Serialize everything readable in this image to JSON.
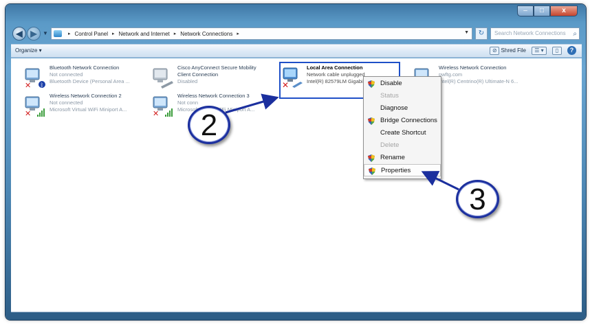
{
  "window": {
    "minimize_glyph": "–",
    "maximize_glyph": "□",
    "close_glyph": "x"
  },
  "navigation": {
    "back_glyph": "◀",
    "forward_glyph": "▶",
    "dropdown_glyph": "▼",
    "breadcrumb": [
      "Control Panel",
      "Network and Internet",
      "Network Connections"
    ],
    "separator": "▸",
    "refresh_glyph": "↻",
    "search_placeholder": "Search Network Connections",
    "search_icon": "search-icon"
  },
  "toolbar": {
    "organize_label": "Organize ▾",
    "shred_label": "Shred File",
    "view_glyph": "☰ ▾",
    "pane_glyph": "▯",
    "help_glyph": "?"
  },
  "connections": [
    {
      "name": "Bluetooth Network Connection",
      "status": "Not connected",
      "device": "Bluetooth Device (Personal Area ..."
    },
    {
      "name": "Cisco AnyConnect Secure Mobility",
      "name2": "Client Connection",
      "status": "Disabled",
      "device": ""
    },
    {
      "name": "Local Area Connection",
      "status": "Network cable unplugged",
      "device": "Intel(R) 82579LM Gigabit"
    },
    {
      "name": "Wireless Network Connection",
      "status": "pwftg.com",
      "device": "Intel(R) Centrino(R) Ultimate-N 6..."
    },
    {
      "name": "Wireless Network Connection 2",
      "status": "Not connected",
      "device": "Microsoft Virtual WiFi Miniport A..."
    },
    {
      "name": "Wireless Network Connection 3",
      "status": "Not conn",
      "device": "Microsoft Virtual WiFi Miniport A..."
    }
  ],
  "context_menu": {
    "items": [
      {
        "label": "Disable",
        "enabled": true,
        "icon": "shield-icon"
      },
      {
        "label": "Status",
        "enabled": false,
        "icon": ""
      },
      {
        "label": "Diagnose",
        "enabled": true,
        "icon": ""
      },
      {
        "label": "Bridge Connections",
        "enabled": true,
        "icon": "shield-icon"
      },
      {
        "label": "Create Shortcut",
        "enabled": true,
        "icon": ""
      },
      {
        "label": "Delete",
        "enabled": false,
        "icon": ""
      },
      {
        "label": "Rename",
        "enabled": true,
        "icon": "shield-icon"
      },
      {
        "label": "Properties",
        "enabled": true,
        "icon": "shield-icon"
      }
    ]
  },
  "callouts": {
    "step2": "2",
    "step3": "3"
  },
  "colors": {
    "frame": "#4c86b3",
    "selection_border": "#1e4fc7",
    "callout_border": "#1b2f9e"
  }
}
